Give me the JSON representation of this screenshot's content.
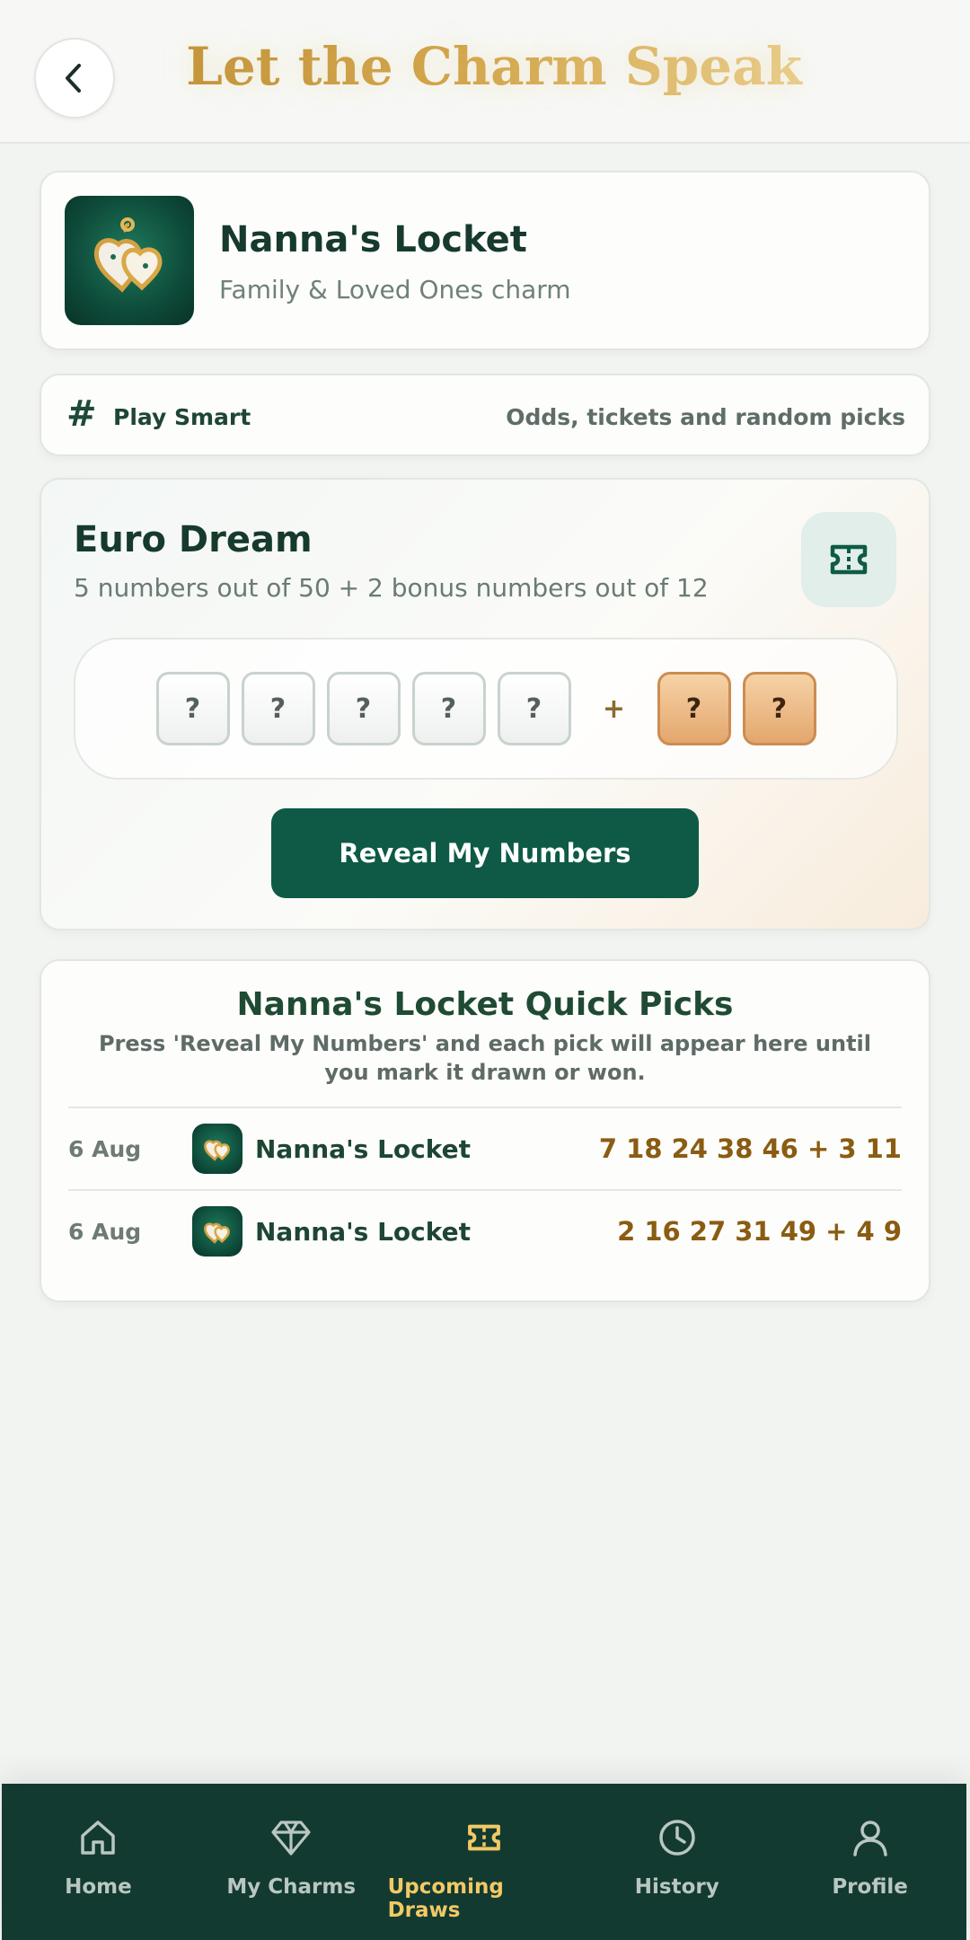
{
  "header": {
    "title": "Let the Charm Speak"
  },
  "charm": {
    "name": "Nanna's Locket",
    "subtitle": "Family & Loved Ones charm"
  },
  "play_smart": {
    "label": "Play Smart",
    "hint": "Odds, tickets and random picks",
    "icon": "#"
  },
  "draw": {
    "title": "Euro Dream",
    "subtitle": "5 numbers out of 50 + 2 bonus numbers out of 12",
    "main_balls": [
      "?",
      "?",
      "?",
      "?",
      "?"
    ],
    "plus": "+",
    "bonus_balls": [
      "?",
      "?"
    ],
    "reveal_label": "Reveal My Numbers"
  },
  "quick_picks": {
    "title": "Nanna's Locket Quick Picks",
    "subtitle": "Press 'Reveal My Numbers' and each pick will appear here until you mark it drawn or won.",
    "rows": [
      {
        "date": "6 Aug",
        "charm": "Nanna's Locket",
        "numbers": "7 18 24 38 46 + 3 11"
      },
      {
        "date": "6 Aug",
        "charm": "Nanna's Locket",
        "numbers": "2 16 27 31 49 + 4 9"
      }
    ]
  },
  "nav": {
    "items": [
      {
        "label": "Home",
        "icon": "home-icon"
      },
      {
        "label": "My Charms",
        "icon": "diamond-icon"
      },
      {
        "label": "Upcoming Draws",
        "icon": "ticket-icon",
        "active": true
      },
      {
        "label": "History",
        "icon": "clock-icon"
      },
      {
        "label": "Profile",
        "icon": "user-icon"
      }
    ]
  },
  "colors": {
    "primary_green": "#0e5a46",
    "nav_background": "#123a30",
    "gold_accent": "#f2c965",
    "number_gold": "#8a5c12",
    "bonus_ball": "#e3a76d"
  }
}
